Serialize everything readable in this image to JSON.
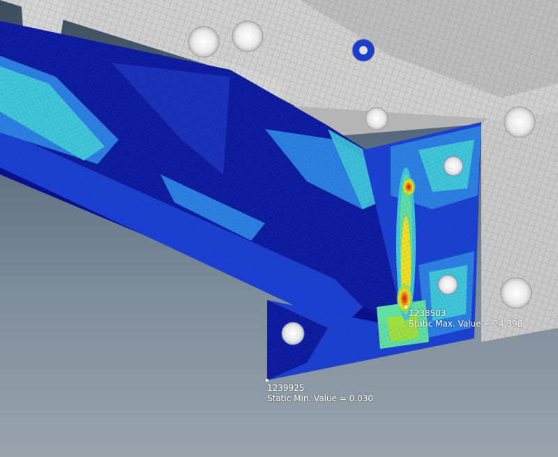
{
  "viewport": {
    "background_top": "#3b4c5f",
    "background_bottom": "#98a3ac",
    "mesh_color": "#d8d8d8",
    "contour_colors": [
      "#0a0f8a",
      "#1a3fcf",
      "#2b7fe0",
      "#3fc7d8",
      "#5fe0a0",
      "#9fe040",
      "#f0e020",
      "#f07010",
      "#d01010"
    ]
  },
  "probes": {
    "max": {
      "node_id": "1238503",
      "text": "Static Max. Value =  24.398"
    },
    "min": {
      "node_id": "1239925",
      "text": "Static Min. Value =  0.030"
    }
  }
}
